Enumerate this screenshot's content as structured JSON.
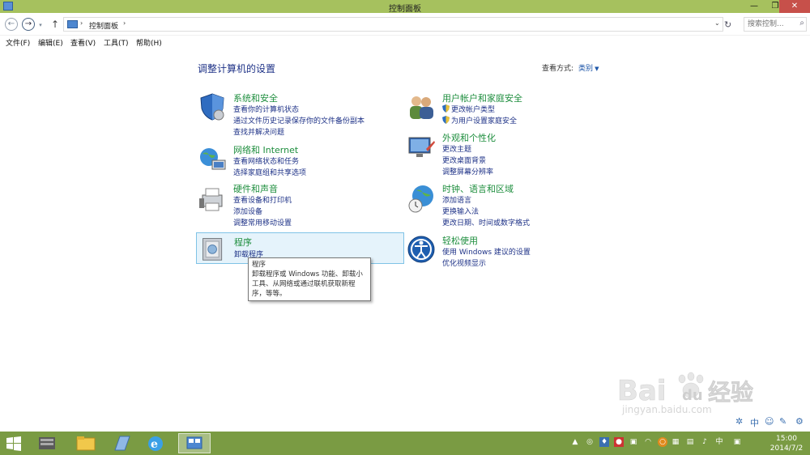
{
  "window": {
    "title": "控制面板",
    "min_glyph": "—",
    "max_glyph": "❐",
    "close_glyph": "✕"
  },
  "address": {
    "crumb": "控制面板",
    "separator": "›",
    "dropdown_glyph": "⌄",
    "refresh_glyph": "↻",
    "search_placeholder": "搜索控制...",
    "search_glyph": "⌕"
  },
  "menu": [
    "文件(F)",
    "编辑(E)",
    "查看(V)",
    "工具(T)",
    "帮助(H)"
  ],
  "header": {
    "title": "调整计算机的设置",
    "viewby_label": "查看方式:",
    "viewby_value": "类别"
  },
  "categories": [
    {
      "title": "系统和安全",
      "icon": "shield-icon",
      "links": [
        "查看你的计算机状态",
        "通过文件历史记录保存你的文件备份副本",
        "查找并解决问题"
      ]
    },
    {
      "title": "网络和 Internet",
      "icon": "network-icon",
      "links": [
        "查看网络状态和任务",
        "选择家庭组和共享选项"
      ]
    },
    {
      "title": "硬件和声音",
      "icon": "printer-icon",
      "links": [
        "查看设备和打印机",
        "添加设备",
        "调整常用移动设置"
      ]
    },
    {
      "title": "程序",
      "icon": "programs-icon",
      "links": [
        "卸载程序"
      ]
    },
    {
      "title": "用户帐户和家庭安全",
      "icon": "users-icon",
      "links": [
        "更改帐户类型",
        "为用户设置家庭安全"
      ]
    },
    {
      "title": "外观和个性化",
      "icon": "appearance-icon",
      "links": [
        "更改主题",
        "更改桌面背景",
        "调整屏幕分辨率"
      ]
    },
    {
      "title": "时钟、语言和区域",
      "icon": "globe-clock-icon",
      "links": [
        "添加语言",
        "更换输入法",
        "更改日期、时间或数字格式"
      ]
    },
    {
      "title": "轻松使用",
      "icon": "ease-of-access-icon",
      "links": [
        "使用 Windows 建议的设置",
        "优化视频显示"
      ]
    }
  ],
  "tooltip": {
    "line1": "程序",
    "line2": "卸载程序或 Windows 功能、卸载小",
    "line3": "工具、从网络或通过联机获取新程",
    "line4": "序，等等。"
  },
  "watermark": {
    "brand": "Bai",
    "paw": "du",
    "suffix": "经验",
    "url": "jingyan.baidu.com"
  },
  "taskbar": {
    "time": "15:00",
    "date": "2014/7/2",
    "ime": "中"
  },
  "colors": {
    "titlebar": "#a6c15e",
    "taskbar": "#7a9b43",
    "category_title": "#1e8e3e",
    "link": "#1e3287"
  }
}
